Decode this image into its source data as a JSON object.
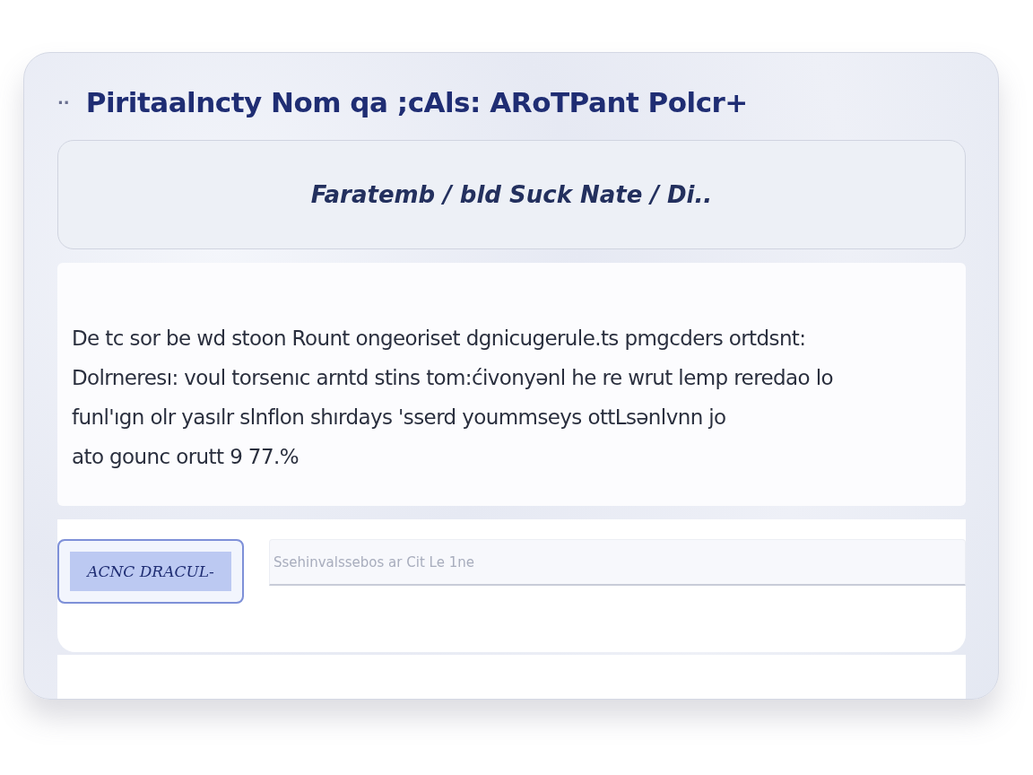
{
  "window": {
    "marker": "··",
    "title": "Piritaalncty Nom qa ;cAls: ARoTPant Polcr+"
  },
  "breadcrumb": {
    "text": "Faratemb / bld Suck Nate / Di.."
  },
  "message": {
    "lines": [
      "De tc sor be wd stoon Rount ongeoriset dgnicugerule.ts pmgcders ortdsnt:",
      "Dolrneresı: voul torsenıc arntd stins tom:ćivonyənl he re wrut lemp reredao lo",
      "funl'ıgn olr yasılr slnflon shırdays 'sserd yoummseys ottLsənlvnn jo",
      "ato gounc orutt 9 77.%"
    ]
  },
  "footer": {
    "button": {
      "label": "ACNC DRACUL-",
      "selected": true
    },
    "field": {
      "placeholder": "Ssehinvalssebos ar Cit Le 1ne"
    }
  }
}
